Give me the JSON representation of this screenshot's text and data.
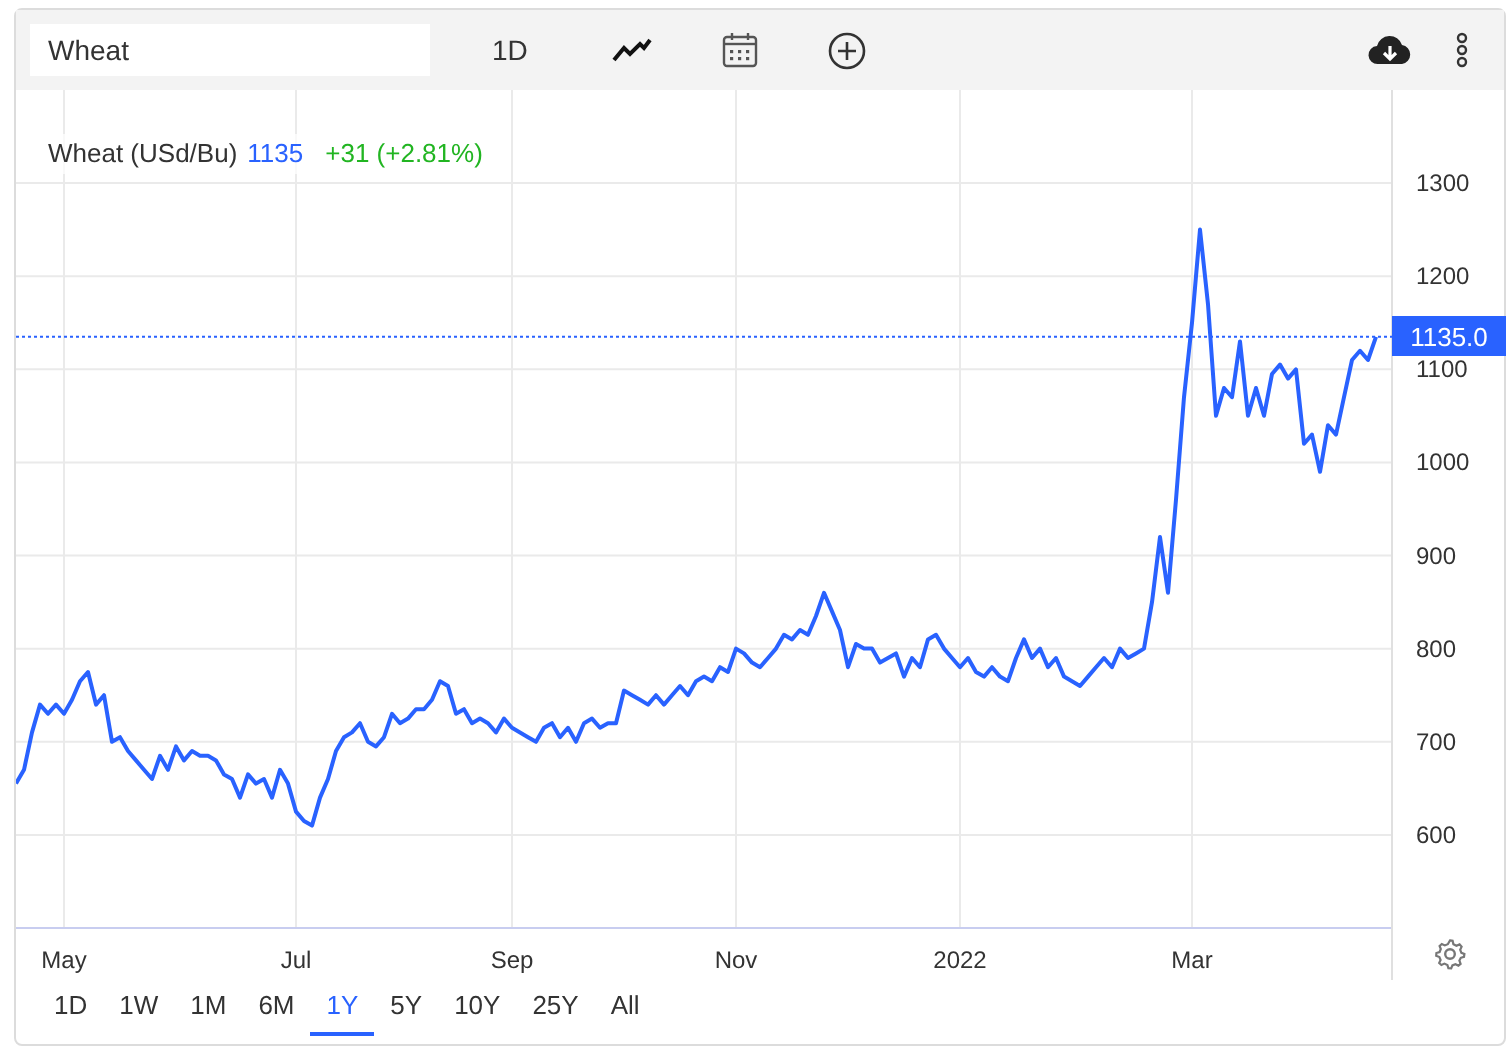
{
  "toolbar": {
    "search": {
      "value": "Wheat"
    },
    "interval": "1D"
  },
  "legend": {
    "name": "Wheat (USd/Bu)",
    "price": "1135",
    "change": "+31 (+2.81%)"
  },
  "price_label": "1135.0",
  "chart_data": {
    "type": "line",
    "ylim": [
      500,
      1400
    ],
    "grid": true,
    "ref_lines": [
      {
        "axis": "y",
        "value": 1135
      }
    ],
    "categories": [
      null,
      null,
      null,
      null,
      null,
      null,
      "May",
      null,
      null,
      null,
      null,
      null,
      null,
      null,
      null,
      null,
      null,
      null,
      null,
      null,
      null,
      null,
      null,
      null,
      null,
      null,
      null,
      null,
      null,
      null,
      null,
      null,
      null,
      null,
      null,
      "Jul",
      null,
      null,
      null,
      null,
      null,
      null,
      null,
      null,
      null,
      null,
      null,
      null,
      null,
      null,
      null,
      null,
      null,
      null,
      null,
      null,
      null,
      null,
      null,
      null,
      null,
      null,
      "Sep",
      null,
      null,
      null,
      null,
      null,
      null,
      null,
      null,
      null,
      null,
      null,
      null,
      null,
      null,
      null,
      null,
      null,
      null,
      null,
      null,
      null,
      null,
      null,
      null,
      null,
      null,
      null,
      "Nov",
      null,
      null,
      null,
      null,
      null,
      null,
      null,
      null,
      null,
      null,
      null,
      null,
      null,
      null,
      null,
      null,
      null,
      null,
      null,
      null,
      null,
      null,
      null,
      null,
      null,
      null,
      null,
      "2022",
      null,
      null,
      null,
      null,
      null,
      null,
      null,
      null,
      null,
      null,
      null,
      null,
      null,
      null,
      null,
      null,
      null,
      null,
      null,
      null,
      null,
      null,
      null,
      null,
      null,
      null,
      null,
      null,
      "Mar",
      null,
      null,
      null,
      null,
      null,
      null,
      null,
      null,
      null,
      null,
      null,
      null,
      null,
      null,
      null,
      null,
      null,
      null,
      null,
      null,
      null,
      null,
      null
    ],
    "yticks": [
      600,
      700,
      800,
      900,
      1000,
      1100,
      1200,
      1300
    ],
    "series": [
      {
        "color": "#2962ff",
        "values": [
          655,
          670,
          710,
          740,
          730,
          740,
          730,
          745,
          765,
          775,
          740,
          750,
          700,
          705,
          690,
          680,
          670,
          660,
          685,
          670,
          695,
          680,
          690,
          685,
          685,
          680,
          665,
          660,
          640,
          665,
          655,
          660,
          640,
          670,
          655,
          625,
          615,
          610,
          640,
          660,
          690,
          705,
          710,
          720,
          700,
          695,
          705,
          730,
          720,
          725,
          735,
          735,
          745,
          765,
          760,
          730,
          735,
          720,
          725,
          720,
          710,
          725,
          715,
          710,
          705,
          700,
          715,
          720,
          705,
          715,
          700,
          720,
          725,
          715,
          720,
          720,
          755,
          750,
          745,
          740,
          750,
          740,
          750,
          760,
          750,
          765,
          770,
          765,
          780,
          775,
          800,
          795,
          785,
          780,
          790,
          800,
          815,
          810,
          820,
          815,
          835,
          860,
          840,
          820,
          780,
          805,
          800,
          800,
          785,
          790,
          795,
          770,
          790,
          780,
          810,
          815,
          800,
          790,
          780,
          790,
          775,
          770,
          780,
          770,
          765,
          790,
          810,
          790,
          800,
          780,
          790,
          770,
          765,
          760,
          770,
          780,
          790,
          780,
          800,
          790,
          795,
          800,
          850,
          920,
          860,
          960,
          1070,
          1150,
          1250,
          1170,
          1050,
          1080,
          1070,
          1130,
          1050,
          1080,
          1050,
          1095,
          1105,
          1090,
          1100,
          1020,
          1030,
          990,
          1040,
          1030,
          1070,
          1110,
          1120,
          1110,
          1135
        ]
      }
    ]
  },
  "ranges": [
    {
      "label": "1D",
      "selected": false
    },
    {
      "label": "1W",
      "selected": false
    },
    {
      "label": "1M",
      "selected": false
    },
    {
      "label": "6M",
      "selected": false
    },
    {
      "label": "1Y",
      "selected": true
    },
    {
      "label": "5Y",
      "selected": false
    },
    {
      "label": "10Y",
      "selected": false
    },
    {
      "label": "25Y",
      "selected": false
    },
    {
      "label": "All",
      "selected": false
    }
  ]
}
